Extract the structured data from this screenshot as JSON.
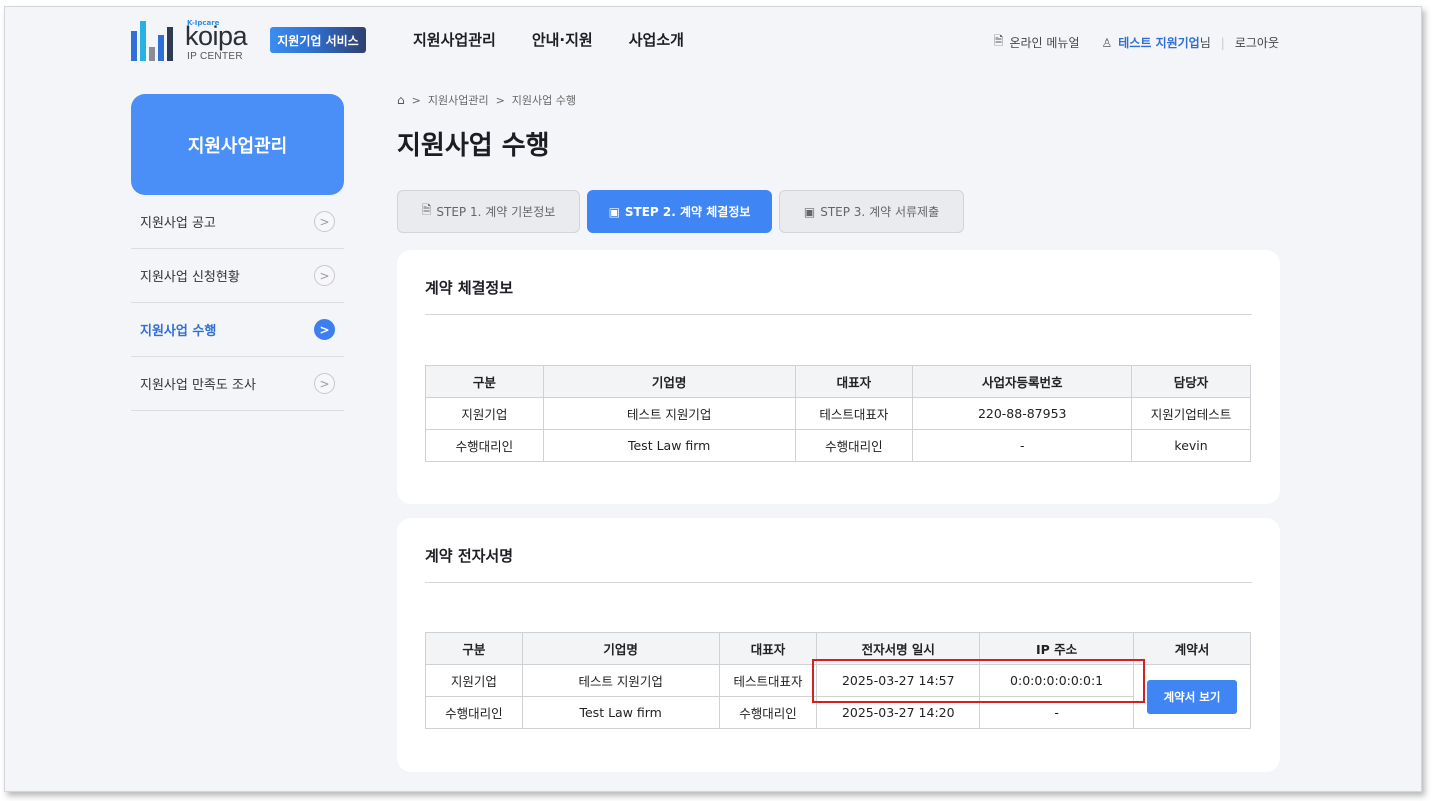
{
  "header": {
    "logo": {
      "small": "K-Ipcare",
      "word": "koipa",
      "sub": "IP CENTER"
    },
    "service_badge": "지원기업 서비스",
    "nav": [
      "지원사업관리",
      "안내·지원",
      "사업소개"
    ],
    "util": {
      "manual": "온라인 메뉴얼",
      "user_name": "테스트 지원기업",
      "user_suffix": "님",
      "sep": "|",
      "logout": "로그아웃"
    }
  },
  "sidebar": {
    "title": "지원사업관리",
    "items": [
      {
        "label": "지원사업 공고",
        "active": false
      },
      {
        "label": "지원사업 신청현황",
        "active": false
      },
      {
        "label": "지원사업 수행",
        "active": true
      },
      {
        "label": "지원사업 만족도 조사",
        "active": false
      }
    ]
  },
  "breadcrumb": [
    "지원사업관리",
    "지원사업 수행"
  ],
  "page_title": "지원사업 수행",
  "steps": [
    {
      "label": "STEP 1. 계약 기본정보",
      "active": false
    },
    {
      "label": "STEP 2. 계약 체결정보",
      "active": true
    },
    {
      "label": "STEP 3. 계약 서류제출",
      "active": false
    }
  ],
  "contract_info": {
    "title": "계약 체결정보",
    "headers": [
      "구분",
      "기업명",
      "대표자",
      "사업자등록번호",
      "담당자"
    ],
    "rows": [
      [
        "지원기업",
        "테스트 지원기업",
        "테스트대표자",
        "220-88-87953",
        "지원기업테스트"
      ],
      [
        "수행대리인",
        "Test Law firm",
        "수행대리인",
        "-",
        "kevin"
      ]
    ]
  },
  "e_signature": {
    "title": "계약 전자서명",
    "headers": [
      "구분",
      "기업명",
      "대표자",
      "전자서명 일시",
      "IP 주소",
      "계약서"
    ],
    "rows": [
      [
        "지원기업",
        "테스트 지원기업",
        "테스트대표자",
        "2025-03-27 14:57",
        "0:0:0:0:0:0:0:1"
      ],
      [
        "수행대리인",
        "Test Law firm",
        "수행대리인",
        "2025-03-27 14:20",
        "-"
      ]
    ],
    "view_button": "계약서 보기"
  },
  "colors": {
    "accent": "#3f85f3",
    "sidebar_title_bg": "#4a8ef7",
    "highlight": "#d81e1e"
  }
}
